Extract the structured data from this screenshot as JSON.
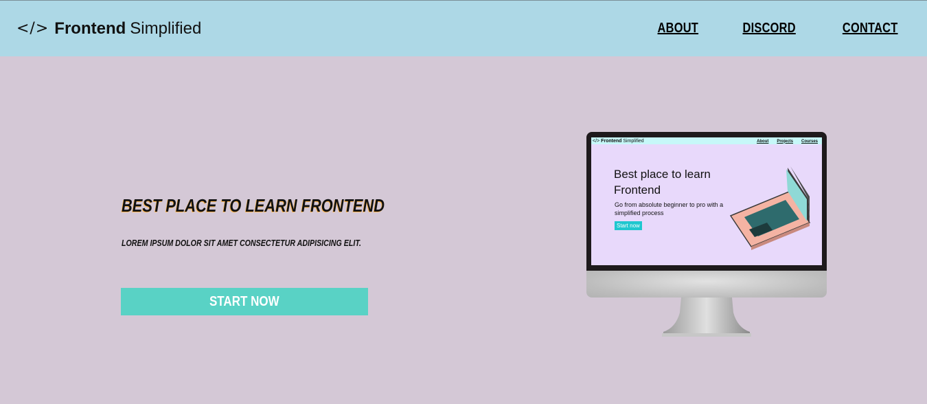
{
  "nav": {
    "logo_icon": "</>",
    "logo_bold": "Frontend",
    "logo_light": "Simplified",
    "links": [
      "ABOUT",
      "DISCORD",
      "CONTACT"
    ]
  },
  "hero": {
    "title": "BEST PLACE TO LEARN FRONTEND",
    "subtitle": "LOREM IPSUM DOLOR SIT AMET CONSECTETUR ADIPISICING ELIT.",
    "cta_label": "START NOW"
  },
  "monitor_screen": {
    "logo_icon": "</>",
    "logo_bold": "Frontend",
    "logo_light": "Simplified",
    "links": [
      "About",
      "Projects",
      "Courses"
    ],
    "title": "Best place to learn Frontend",
    "subtitle": "Go from absolute beginner to pro with a simplified process",
    "button": "Start now"
  },
  "colors": {
    "nav_bg": "#add8e6",
    "page_bg": "#d4c8d6",
    "cta_bg": "#59d2c5",
    "title_shadow": "#ffb74d"
  },
  "icons": {
    "logo": "code-brackets-icon",
    "illustration": "laptop-icon"
  }
}
